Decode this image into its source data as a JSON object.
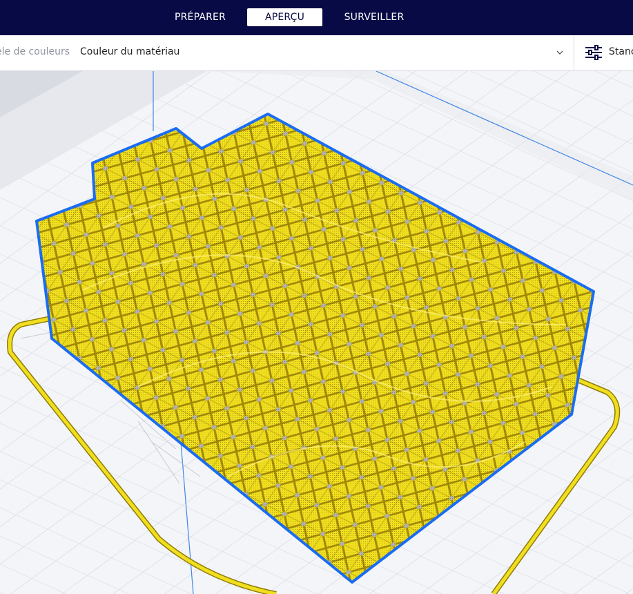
{
  "stages": {
    "prepare": "PRÉPARER",
    "preview": "APERÇU",
    "monitor": "SURVEILLER"
  },
  "color_scheme": {
    "label": "èle de couleurs",
    "value": "Couleur du matériau"
  },
  "print_settings": {
    "label": "Stanc"
  },
  "colors": {
    "header_bg": "#080a45",
    "material": "#f1df1f",
    "outline": "#1a6cf2",
    "grid": "#d4d8e0"
  },
  "icons": {
    "settings": "sliders-icon",
    "dropdown": "chevron-down-icon"
  }
}
